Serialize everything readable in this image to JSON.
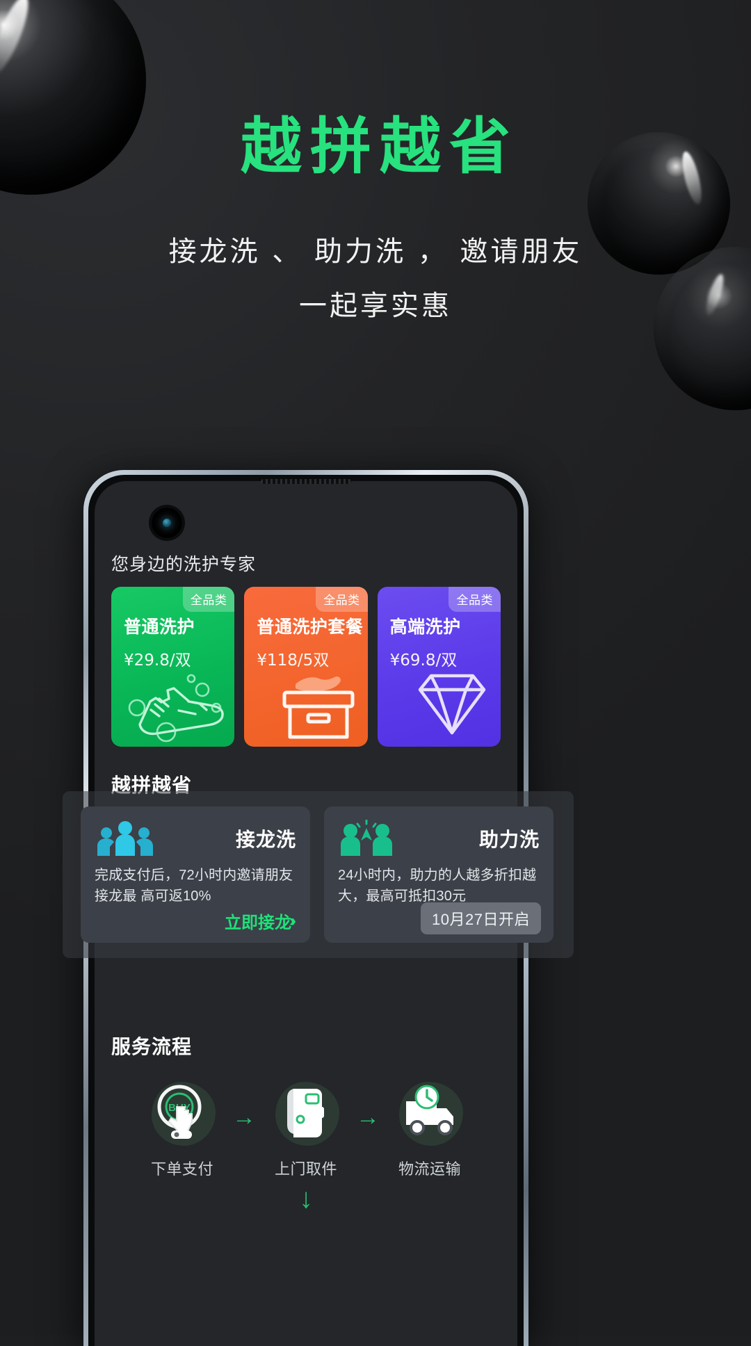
{
  "hero": {
    "title": "越拼越省",
    "subtitle_line1": "接龙洗 、 助力洗 ，  邀请朋友",
    "subtitle_line2": "一起享实惠",
    "title_color": "#27e27e"
  },
  "phone": {
    "app_header": "您身边的洗护专家",
    "products": [
      {
        "tag": "全品类",
        "title": "普通洗护",
        "price": "¥29.8/双",
        "color": "#09b757",
        "icon": "sneaker-icon"
      },
      {
        "tag": "全品类",
        "title": "普通洗护套餐",
        "price": "¥118/5双",
        "color": "#f4662f",
        "icon": "shoe-box-icon"
      },
      {
        "tag": "全品类",
        "title": "高端洗护",
        "price": "¥69.8/双",
        "color": "#5b3ae9",
        "icon": "diamond-icon"
      }
    ],
    "promo_section": {
      "heading": "越拼越省",
      "underline_color": "#17a65a",
      "cards": [
        {
          "icon": "group-people-icon",
          "icon_color": "#29b6d8",
          "title": "接龙洗",
          "desc": "完成支付后，72小时内邀请朋友接龙最 高可返10%",
          "cta": "立即接龙",
          "cta_color": "#20e07a"
        },
        {
          "icon": "high-five-icon",
          "icon_color": "#18b889",
          "title": "助力洗",
          "desc": "24小时内，助力的人越多折扣越大，最高可抵扣30元",
          "badge": "10月27日开启"
        }
      ]
    },
    "flow_section": {
      "heading": "服务流程",
      "underline_color": "#17a65a",
      "arrow": "→",
      "down_arrow": "↓",
      "steps": [
        {
          "label": "下单支付",
          "icon": "buy-tap-icon"
        },
        {
          "label": "上门取件",
          "icon": "pickup-bag-icon"
        },
        {
          "label": "物流运输",
          "icon": "delivery-truck-icon"
        }
      ]
    }
  }
}
